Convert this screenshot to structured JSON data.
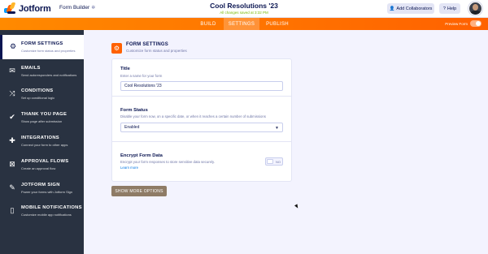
{
  "header": {
    "logo_text": "Jotform",
    "builder_label": "Form Builder",
    "form_title": "Cool Resolutions '23",
    "save_status": "All changes saved at 3:32 PM",
    "add_collaborators": "Add Collaborators",
    "help": "Help"
  },
  "nav": {
    "tabs": [
      "BUILD",
      "SETTINGS",
      "PUBLISH"
    ],
    "active": "SETTINGS",
    "preview_label": "Preview Form"
  },
  "sidebar": {
    "items": [
      {
        "title": "FORM SETTINGS",
        "desc": "Customize form status and properties",
        "icon": "gear-icon",
        "active": true
      },
      {
        "title": "EMAILS",
        "desc": "Send autoresponders and notifications",
        "icon": "envelope-icon"
      },
      {
        "title": "CONDITIONS",
        "desc": "Set up conditional logic",
        "icon": "shuffle-icon"
      },
      {
        "title": "THANK YOU PAGE",
        "desc": "Show page after submission",
        "icon": "check-circle-icon"
      },
      {
        "title": "INTEGRATIONS",
        "desc": "Connect your form to other apps",
        "icon": "puzzle-icon"
      },
      {
        "title": "APPROVAL FLOWS",
        "desc": "Create an approval flow",
        "icon": "approval-flow-icon"
      },
      {
        "title": "JOTFORM SIGN",
        "desc": "Power your forms with Jotform Sign",
        "icon": "pen-icon"
      },
      {
        "title": "MOBILE NOTIFICATIONS",
        "desc": "Customize mobile app notifications",
        "icon": "phone-icon"
      }
    ]
  },
  "main": {
    "section_title": "FORM SETTINGS",
    "section_sub": "Customize form status and properties",
    "title_block": {
      "label": "Title",
      "sub": "Enter a name for your form",
      "value": "Cool Resolutions '23"
    },
    "status_block": {
      "label": "Form Status",
      "sub": "Disable your form now, on a specific date, or when it reaches a certain number of submissions",
      "value": "Enabled"
    },
    "encrypt_block": {
      "label": "Encrypt Form Data",
      "sub": "Encrypt your form responses to store sensitive data securely.",
      "link": "Learn more",
      "toggle_state": "NO"
    },
    "more_button": "SHOW MORE OPTIONS"
  },
  "colors": {
    "brand_orange": "#ff6100",
    "sidebar_bg": "#293241",
    "navy": "#0a1551",
    "more_button_bg": "#8e7b66"
  }
}
